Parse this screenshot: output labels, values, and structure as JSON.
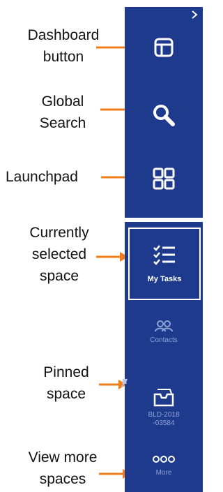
{
  "annotations": {
    "dashboard": "Dashboard\nbutton",
    "search": "Global\nSearch",
    "launchpad": "Launchpad",
    "selected": "Currently\nselected\nspace",
    "pinned": "Pinned\nspace",
    "more": "View more\nspaces"
  },
  "sidebar": {
    "selected_space": {
      "label": "My Tasks",
      "icon": "checklist-icon"
    },
    "spaces": [
      {
        "label": "Contacts",
        "icon": "contacts-icon"
      },
      {
        "label": "BLD-2018\n-03584",
        "icon": "inbox-tray-icon"
      },
      {
        "label": "More",
        "icon": "more-dots-icon"
      }
    ]
  },
  "colors": {
    "sidebar_bg": "#1d3a8c",
    "arrow": "#f07d1a",
    "icon_white": "#ffffff",
    "icon_muted": "#8fa4d6"
  }
}
